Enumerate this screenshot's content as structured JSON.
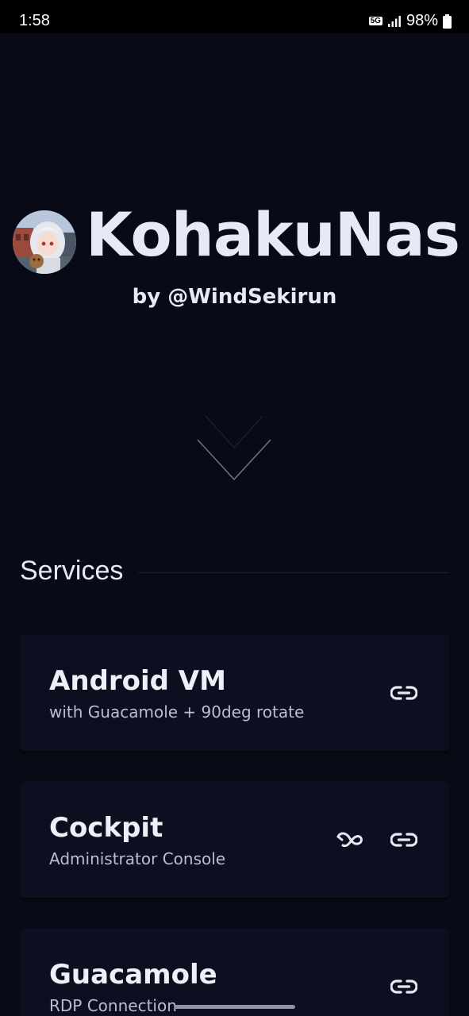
{
  "status_bar": {
    "time": "1:58",
    "network": "5G",
    "battery": "98%"
  },
  "header": {
    "title": "KohakuNas",
    "subtitle": "by @WindSekirun",
    "avatar_icon": "avatar-anime-girl"
  },
  "services": {
    "heading": "Services",
    "items": [
      {
        "title": "Android VM",
        "description": "with Guacamole + 90deg rotate",
        "actions": [
          "link-icon"
        ]
      },
      {
        "title": "Cockpit",
        "description": "Administrator Console",
        "actions": [
          "cockpit-logo-icon",
          "link-icon"
        ]
      },
      {
        "title": "Guacamole",
        "description": "RDP Connection",
        "actions": [
          "link-icon"
        ]
      }
    ]
  },
  "colors": {
    "background": "#080b16",
    "card": "#0b0f1f",
    "text": "#e7eaf6",
    "muted": "#b9bfcd"
  }
}
